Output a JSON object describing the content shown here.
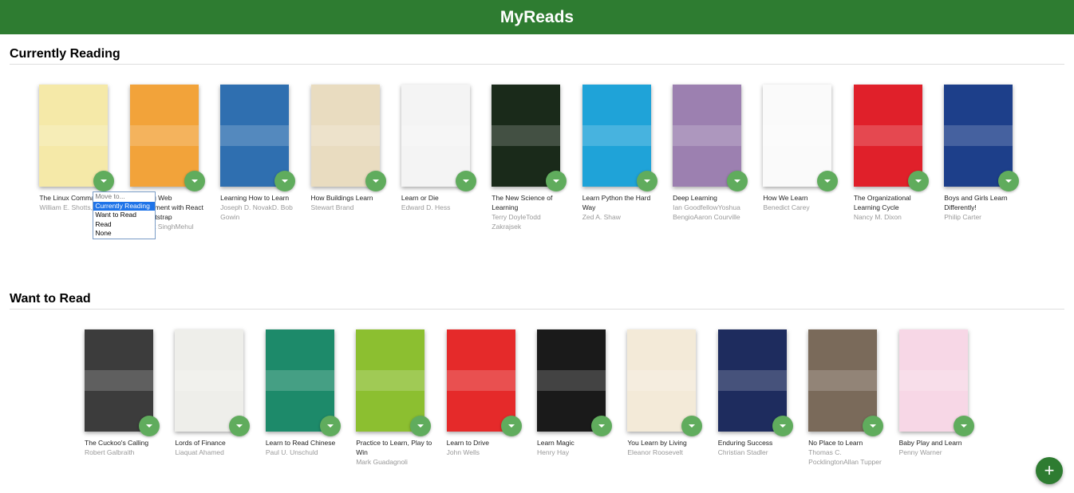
{
  "app": {
    "title": "MyReads"
  },
  "shelves": [
    {
      "title": "Currently Reading",
      "books": [
        {
          "title": "The Linux Command Line",
          "authors": "William E. Shotts, Jr.",
          "cover_color": "#f5e9a8"
        },
        {
          "title": "Learning Web Development with React and Bootstrap",
          "authors": "Harmeet SinghMehul Bhatt",
          "cover_color": "#f2a33a"
        },
        {
          "title": "Learning How to Learn",
          "authors": "Joseph D. NovakD. Bob Gowin",
          "cover_color": "#2f6fb0"
        },
        {
          "title": "How Buildings Learn",
          "authors": "Stewart Brand",
          "cover_color": "#e9dcc0"
        },
        {
          "title": "Learn or Die",
          "authors": "Edward D. Hess",
          "cover_color": "#f4f4f4"
        },
        {
          "title": "The New Science of Learning",
          "authors": "Terry DoyleTodd Zakrajsek",
          "cover_color": "#1a2a1a"
        },
        {
          "title": "Learn Python the Hard Way",
          "authors": "Zed A. Shaw",
          "cover_color": "#1fa3d8"
        },
        {
          "title": "Deep Learning",
          "authors": "Ian GoodfellowYoshua BengioAaron Courville",
          "cover_color": "#9c80b0"
        },
        {
          "title": "How We Learn",
          "authors": "Benedict Carey",
          "cover_color": "#fafafa"
        },
        {
          "title": "The Organizational Learning Cycle",
          "authors": "Nancy M. Dixon",
          "cover_color": "#e0202a"
        },
        {
          "title": "Boys and Girls Learn Differently!",
          "authors": "Philip Carter",
          "cover_color": "#1d3f8a"
        }
      ]
    },
    {
      "title": "Want to Read",
      "books": [
        {
          "title": "The Cuckoo's Calling",
          "authors": "Robert Galbraith",
          "cover_color": "#3c3c3c"
        },
        {
          "title": "Lords of Finance",
          "authors": "Liaquat Ahamed",
          "cover_color": "#eeeeea"
        },
        {
          "title": "Learn to Read Chinese",
          "authors": "Paul U. Unschuld",
          "cover_color": "#1d8a6a"
        },
        {
          "title": "Practice to Learn, Play to Win",
          "authors": "Mark Guadagnoli",
          "cover_color": "#8cbf30"
        },
        {
          "title": "Learn to Drive",
          "authors": "John Wells",
          "cover_color": "#e52a2a"
        },
        {
          "title": "Learn Magic",
          "authors": "Henry Hay",
          "cover_color": "#1a1a1a"
        },
        {
          "title": "You Learn by Living",
          "authors": "Eleanor Roosevelt",
          "cover_color": "#f3ead8"
        },
        {
          "title": "Enduring Success",
          "authors": "Christian Stadler",
          "cover_color": "#1e2c5e"
        },
        {
          "title": "No Place to Learn",
          "authors": "Thomas C. PocklingtonAllan Tupper",
          "cover_color": "#7a6a5a"
        },
        {
          "title": "Baby Play and Learn",
          "authors": "Penny Warner",
          "cover_color": "#f7d7e6"
        }
      ]
    }
  ],
  "shelf_changer": {
    "options": [
      "Move to...",
      "Currently Reading",
      "Want to Read",
      "Read",
      "None"
    ],
    "selected": "Currently Reading"
  },
  "fab": {
    "label": "+",
    "icon": "plus-icon"
  }
}
